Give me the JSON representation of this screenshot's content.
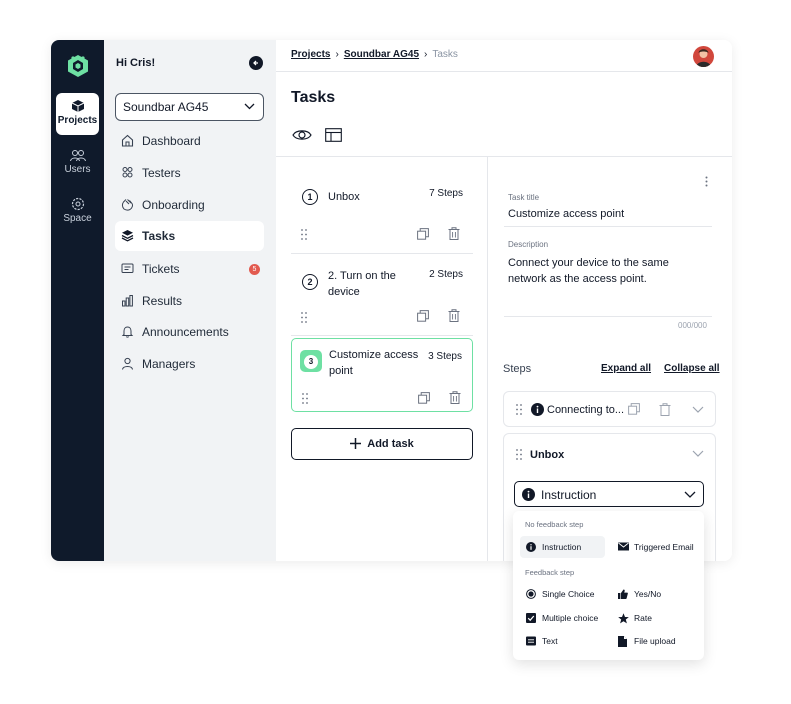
{
  "rail": {
    "items": [
      {
        "label": "Projects",
        "active": true
      },
      {
        "label": "Users",
        "active": false
      },
      {
        "label": "Space",
        "active": false
      }
    ]
  },
  "sidebar": {
    "greeting": "Hi Cris!",
    "project_select": "Soundbar AG45",
    "items": [
      {
        "label": "Dashboard",
        "icon": "home-icon"
      },
      {
        "label": "Testers",
        "icon": "testers-icon"
      },
      {
        "label": "Onboarding",
        "icon": "wave-hand-icon"
      },
      {
        "label": "Tasks",
        "icon": "layers-icon",
        "active": true
      },
      {
        "label": "Tickets",
        "icon": "ticket-icon",
        "badge": "5"
      },
      {
        "label": "Results",
        "icon": "bar-chart-icon"
      },
      {
        "label": "Announcements",
        "icon": "bell-icon"
      },
      {
        "label": "Managers",
        "icon": "user-icon"
      }
    ]
  },
  "breadcrumb": {
    "items": [
      "Projects",
      "Soundbar AG45"
    ],
    "current": "Tasks"
  },
  "page": {
    "title": "Tasks"
  },
  "tasks": [
    {
      "number": "1",
      "name": "Unbox",
      "steps": "7 Steps"
    },
    {
      "number": "2",
      "name": "2. Turn on the device",
      "steps": "2 Steps"
    },
    {
      "number": "3",
      "name": "Customize access point",
      "steps": "3 Steps",
      "selected": true
    }
  ],
  "add_task_label": "Add task",
  "detail": {
    "title_label": "Task title",
    "title_value": "Customize access point",
    "description_label": "Description",
    "description_value": "Connect your device to the same network as the access point.",
    "counter": "000/000",
    "steps_heading": "Steps",
    "expand_all": "Expand all",
    "collapse_all": "Collapse all",
    "step_collapsed": "Connecting to...",
    "step_open_title": "Unbox",
    "step_type_value": "Instruction"
  },
  "dropdown": {
    "no_feedback_heading": "No feedback step",
    "feedback_heading": "Feedback step",
    "no_feedback_items": [
      "Instruction",
      "Triggered Email"
    ],
    "feedback_items": [
      "Single Choice",
      "Yes/No",
      "Multiple choice",
      "Rate",
      "Text",
      "File upload"
    ]
  },
  "colors": {
    "rail_bg": "#0f1a2b",
    "accent_green": "#6ee0a3",
    "badge_red": "#e25a4f"
  }
}
